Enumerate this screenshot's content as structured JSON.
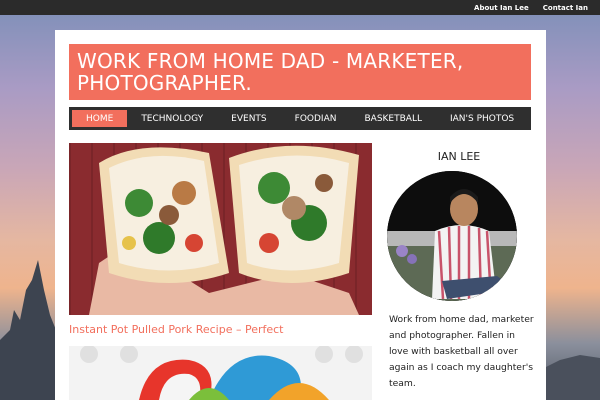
{
  "topbar": {
    "links": [
      "About Ian Lee",
      "Contact Ian"
    ]
  },
  "header": {
    "title": "WORK FROM HOME DAD - MARKETER, PHOTOGRAPHER."
  },
  "nav": {
    "items": [
      "HOME",
      "TECHNOLOGY",
      "EVENTS",
      "FOODIAN",
      "BASKETBALL",
      "IAN'S PHOTOS"
    ],
    "active": "HOME"
  },
  "posts": [
    {
      "title": "Instant Pot Pulled Pork Recipe – Perfect"
    }
  ],
  "sidebar": {
    "widget_title": "IAN LEE",
    "bio": "Work from home dad, marketer and photographer. Fallen in love with basketball all over again as I coach my daughter's team."
  },
  "colors": {
    "accent": "#f26f5d",
    "nav_bg": "#2f2f2f",
    "topbar_bg": "#2b2b2b"
  }
}
